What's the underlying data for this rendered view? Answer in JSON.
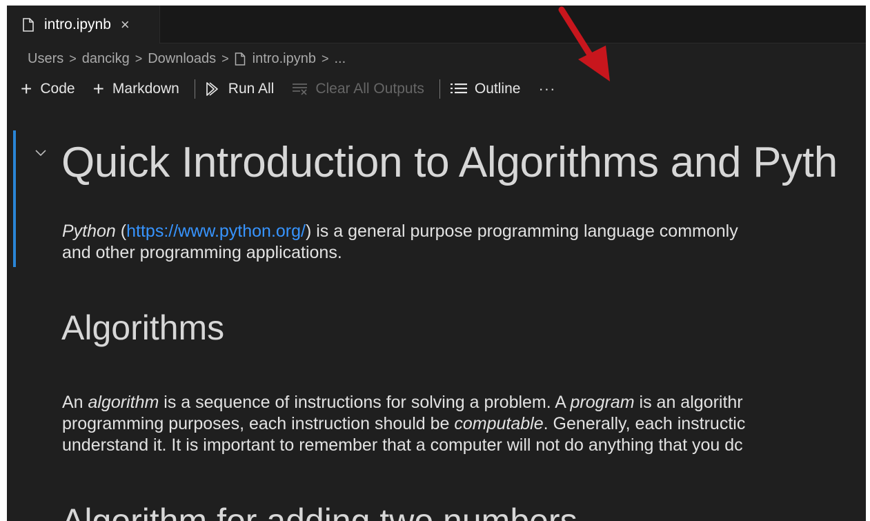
{
  "tab": {
    "title": "intro.ipynb",
    "close_symbol": "×",
    "icon": "file-icon"
  },
  "breadcrumb": {
    "items": [
      "Users",
      "dancikg",
      "Downloads",
      "intro.ipynb",
      "..."
    ],
    "separator": ">"
  },
  "toolbar": {
    "code_label": "Code",
    "markdown_label": "Markdown",
    "run_all_label": "Run All",
    "clear_outputs_label": "Clear All Outputs",
    "outline_label": "Outline",
    "more_label": "···"
  },
  "notebook": {
    "title": "Quick Introduction to Algorithms and Pyth",
    "intro_line1_em": "Python",
    "intro_line1_link": "https://www.python.org/",
    "intro_line1_rest": ") is a general purpose programming language commonly",
    "intro_line2": "and other programming applications.",
    "section_title": "Algorithms",
    "algo_line1_a": "An ",
    "algo_line1_em1": "algorithm",
    "algo_line1_b": " is a sequence of instructions for solving a problem. A ",
    "algo_line1_em2": "program",
    "algo_line1_c": " is an algorithr",
    "algo_line2_a": "programming purposes, each instruction should be ",
    "algo_line2_em": "computable",
    "algo_line2_b": ". Generally, each instructic",
    "algo_line3": "understand it. It is important to remember that a computer will not do anything that you dc",
    "subsection_title": "Algorithm for adding two numbers"
  },
  "colors": {
    "editor_bg": "#1f1f1f",
    "accent": "#2a85d6",
    "link": "#3794ff",
    "annotation_arrow": "#c8161d"
  }
}
